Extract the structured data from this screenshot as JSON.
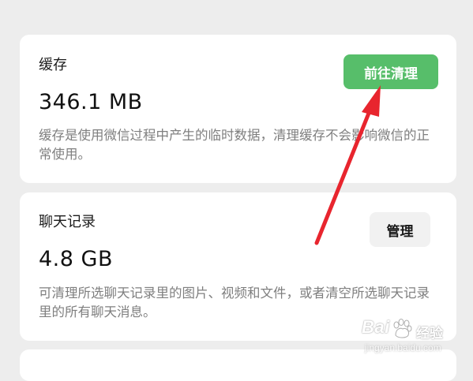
{
  "cache": {
    "title": "缓存",
    "size": "346.1 MB",
    "button_label": "前往清理",
    "description": "缓存是使用微信过程中产生的临时数据，清理缓存不会影响微信的正常使用。"
  },
  "chat_history": {
    "title": "聊天记录",
    "size": "4.8 GB",
    "button_label": "管理",
    "description": "可清理所选聊天记录里的图片、视频和文件，或者清空所选聊天记录里的所有聊天消息。"
  },
  "watermark": {
    "brand_latin": "Bai",
    "brand_cn": "经验",
    "url": "jingyan.baidu.com"
  },
  "colors": {
    "background": "#ededed",
    "card": "#ffffff",
    "accent_green": "#57be6a",
    "annotation_red": "#e8252e",
    "secondary_text": "#7f7f7f"
  },
  "icons": [
    "red-annotation-arrow-icon",
    "baidu-paw-icon"
  ]
}
